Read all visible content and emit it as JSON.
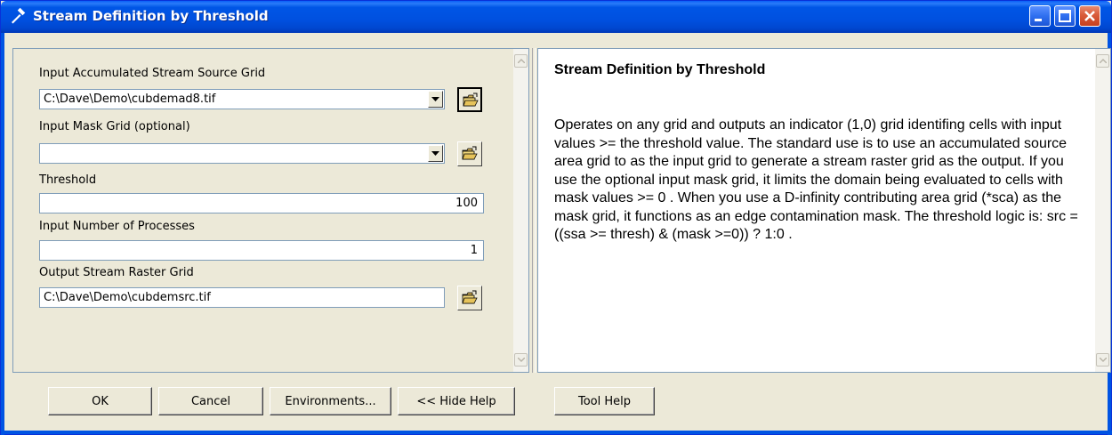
{
  "window": {
    "title": "Stream Definition by Threshold",
    "icon": "hammer-icon",
    "controls": [
      "minimize-icon",
      "maximize-icon",
      "close-icon"
    ]
  },
  "form": {
    "source_grid": {
      "label": "Input Accumulated Stream Source Grid",
      "value": "C:\\Dave\\Demo\\cubdemad8.tif"
    },
    "mask_grid": {
      "label": "Input Mask Grid (optional)",
      "value": ""
    },
    "threshold": {
      "label": "Threshold",
      "value": "100"
    },
    "processes": {
      "label": "Input Number of Processes",
      "value": "1"
    },
    "output_grid": {
      "label": "Output Stream Raster Grid",
      "value": "C:\\Dave\\Demo\\cubdemsrc.tif"
    }
  },
  "help": {
    "title": "Stream Definition by Threshold",
    "body": "Operates on any grid and outputs an indicator (1,0) grid identifing cells with input values >= the threshold value. The standard use is to use an accumulated source area grid to as the input grid to generate a stream raster grid as the output. If you use the optional input mask grid, it limits the domain being evaluated to cells with mask values >= 0 . When you use a D-infinity contributing area grid (*sca) as the mask grid, it functions as an edge contamination mask. The threshold logic is: src = ((ssa >= thresh) & (mask >=0)) ? 1:0 ."
  },
  "buttons": {
    "ok": "OK",
    "cancel": "Cancel",
    "environments": "Environments...",
    "hide_help": "<< Hide Help",
    "tool_help": "Tool Help"
  },
  "colors": {
    "titlebar": "#0054e3",
    "face": "#ece9d8",
    "close_button": "#d95b3a"
  }
}
